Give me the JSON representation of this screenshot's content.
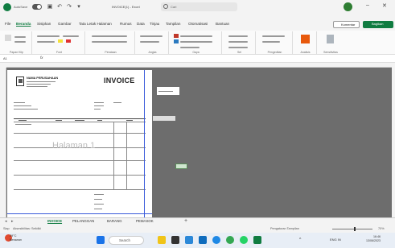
{
  "titlebar": {
    "autosave_label": "AutoSave",
    "doc_title": "INVOICE(1) - Excel",
    "search_placeholder": "Cari",
    "minimize_icon": "–",
    "close_icon": "✕"
  },
  "ribbon_tabs": [
    "File",
    "Beranda",
    "Sisipkan",
    "Gambar",
    "Tata Letak Halaman",
    "Rumus",
    "Data",
    "Tinjau",
    "Tampilan",
    "Otomatisasi",
    "Bantuan"
  ],
  "active_tab": "Beranda",
  "ribbon_buttons": {
    "comments": "Komentar",
    "share": "Bagikan"
  },
  "ribbon_groups": [
    "Papan Klip",
    "Font",
    "Perataan",
    "Angka",
    "Gaya",
    "Sel",
    "Pengeditan",
    "Analisis",
    "Sensitivitas"
  ],
  "formula_bar": {
    "namebox": "A1",
    "fx": "fx"
  },
  "invoice": {
    "company": "NAMA PERUSAHAAN",
    "title": "INVOICE",
    "page_watermark": "Halaman 1"
  },
  "sheet_tabs": [
    "INVOICE",
    "PELANGGAN",
    "BARANG",
    "PEMASOK"
  ],
  "active_sheet": "INVOICE",
  "status": {
    "ready": "Siap",
    "accessibility": "Aksesibilitas: Selidiki",
    "display": "Pengaturan Tampilan",
    "zoom": "70%"
  },
  "taskbar": {
    "weather_temp": "29°C",
    "weather_desc": "Berawan",
    "search": "Search",
    "time": "16:46",
    "date": "13/06/2023",
    "lang": "ENG IN"
  },
  "colors": {
    "accent": "#107c41",
    "page_break": "#3b5bdb",
    "gray_area": "#6d6d6d"
  }
}
